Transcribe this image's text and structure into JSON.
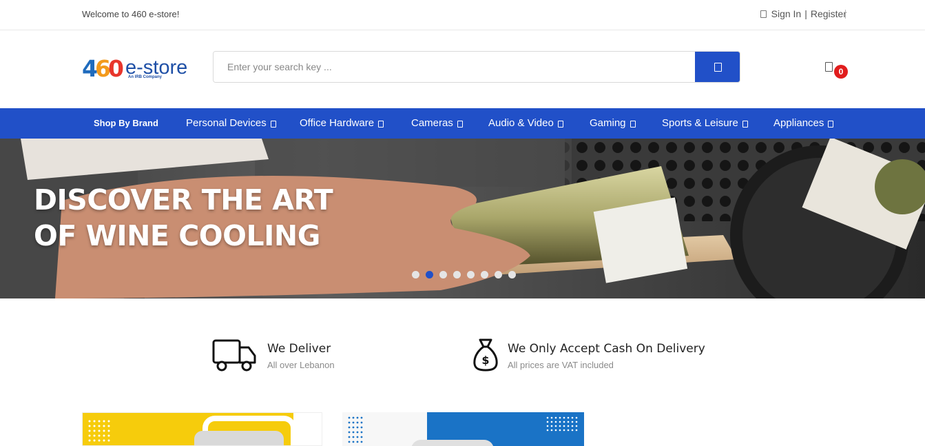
{
  "topbar": {
    "welcome": "Welcome to 460 e-store!",
    "sign_in": "Sign In",
    "separator": "|",
    "register": "Register"
  },
  "header": {
    "logo": {
      "digits": [
        "4",
        "6",
        "0"
      ],
      "wordmark": "e-store",
      "tagline": "An IRB Company"
    },
    "search": {
      "placeholder": "Enter your search key ...",
      "value": "",
      "button_icon": "search-icon"
    },
    "cart": {
      "icon": "shopping-bag-icon",
      "count": "0"
    }
  },
  "nav": {
    "items": [
      {
        "label": "Shop By Brand"
      },
      {
        "label": "Personal Devices"
      },
      {
        "label": "Office Hardware"
      },
      {
        "label": "Cameras"
      },
      {
        "label": "Audio & Video"
      },
      {
        "label": "Gaming"
      },
      {
        "label": "Sports & Leisure"
      },
      {
        "label": "Appliances"
      }
    ]
  },
  "hero": {
    "title_line1": "DISCOVER THE ART",
    "title_line2": "OF WINE COOLING",
    "slides": 8,
    "active_slide": 2
  },
  "features": [
    {
      "icon": "delivery-truck-icon",
      "title": "We Deliver",
      "subtitle": "All over Lebanon"
    },
    {
      "icon": "money-bag-icon",
      "title": "We Only Accept Cash On Delivery",
      "subtitle": "All prices are VAT included"
    }
  ],
  "colors": {
    "brand_blue": "#2150c8",
    "badge_red": "#e11d1d",
    "promo_yellow": "#f6cc0c",
    "promo_blue": "#1a73c6"
  }
}
